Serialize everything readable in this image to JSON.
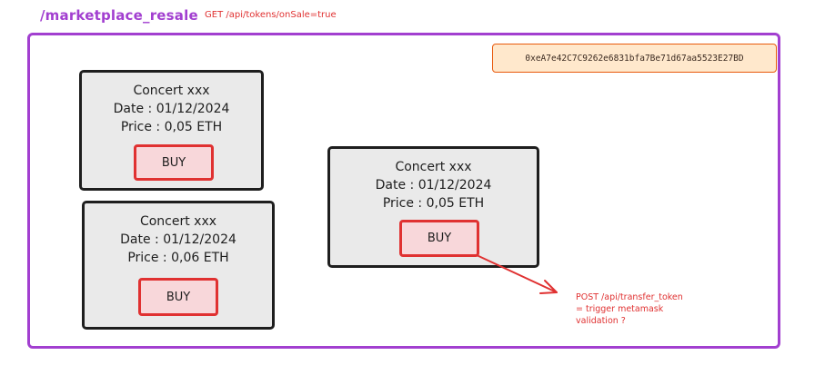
{
  "header": {
    "route": "/marketplace_resale",
    "get_call": "GET /api/tokens/onSale=true"
  },
  "wallet": {
    "address": "0xeA7e42C7C9262e6831bfa7Be71d67aa5523E27BD"
  },
  "cards": [
    {
      "title": "Concert xxx",
      "date": "Date : 01/12/2024",
      "price": "Price : 0,05 ETH",
      "buy_label": "BUY"
    },
    {
      "title": "Concert xxx",
      "date": "Date : 01/12/2024",
      "price": "Price : 0,06 ETH",
      "buy_label": "BUY"
    },
    {
      "title": "Concert xxx",
      "date": "Date : 01/12/2024",
      "price": "Price : 0,05 ETH",
      "buy_label": "BUY"
    }
  ],
  "note": {
    "lines": [
      "POST /api/transfer_token",
      "= trigger metamask",
      "validation ?"
    ]
  },
  "colors": {
    "frame": "#a23fd0",
    "accent_red": "#e03131",
    "wallet_fill": "#ffe8cc",
    "wallet_border": "#e8590c",
    "card_fill": "#eaeaea",
    "buy_fill": "#f8d7da"
  }
}
